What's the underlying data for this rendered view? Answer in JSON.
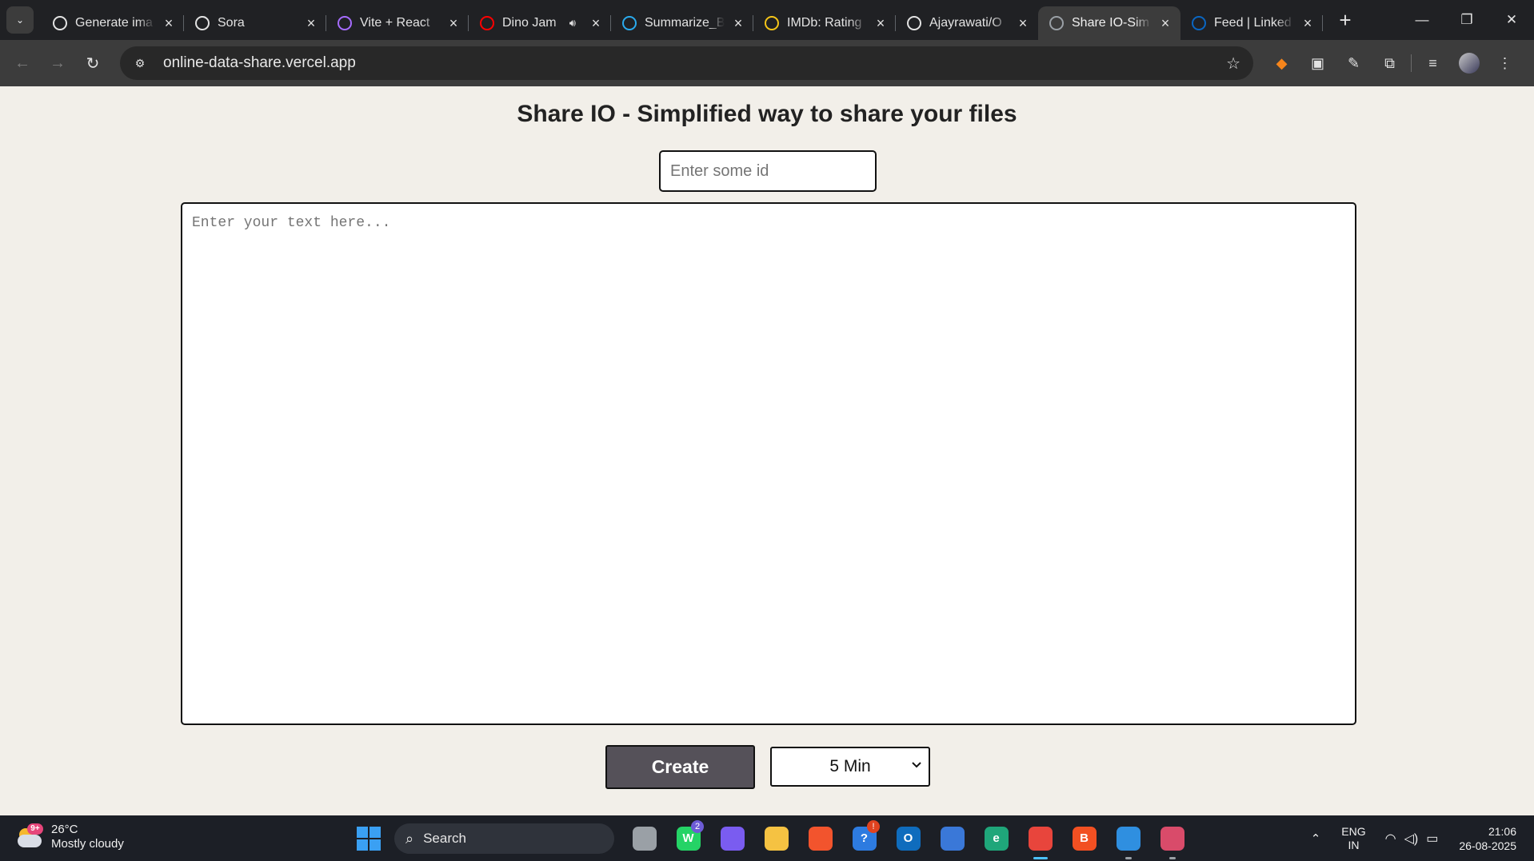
{
  "browser": {
    "tabs": [
      {
        "title": "Generate ima",
        "icon": "openai-icon",
        "icon_color": "#e3e3e3"
      },
      {
        "title": "Sora",
        "icon": "sora-icon",
        "icon_color": "#e3e3e3"
      },
      {
        "title": "Vite + React",
        "icon": "vite-icon",
        "icon_color": "#a66cff"
      },
      {
        "title": "Dino Jam",
        "icon": "youtube-icon",
        "icon_color": "#ff0000"
      },
      {
        "title": "Summarize_B",
        "icon": "telegram-icon",
        "icon_color": "#2aabee"
      },
      {
        "title": "IMDb: Rating",
        "icon": "imdb-icon",
        "icon_color": "#f5c518"
      },
      {
        "title": "Ajayrawati/O",
        "icon": "github-icon",
        "icon_color": "#e3e3e3"
      },
      {
        "title": "Share IO-Sim",
        "icon": "globe-icon",
        "icon_color": "#9aa0a6"
      },
      {
        "title": "Feed | Linked",
        "icon": "linkedin-icon",
        "icon_color": "#0a66c2"
      }
    ],
    "active_tab_index": 7,
    "url": "online-data-share.vercel.app"
  },
  "page": {
    "title": "Share IO - Simplified way to share your files",
    "id_input": {
      "placeholder": "Enter some id",
      "value": ""
    },
    "text_area": {
      "placeholder": "Enter your text here...",
      "value": ""
    },
    "create_button": "Create",
    "expiry_select": {
      "selected": "5 Min"
    }
  },
  "taskbar": {
    "weather": {
      "temp": "26°C",
      "condition": "Mostly cloudy",
      "badge": "9+"
    },
    "search_label": "Search",
    "apps": [
      {
        "name": "task-view",
        "color": "#9aa0a6",
        "glyph": "",
        "badge": "",
        "dot": ""
      },
      {
        "name": "whatsapp",
        "color": "#25d366",
        "glyph": "W",
        "badge": "2",
        "dot": ""
      },
      {
        "name": "copilot",
        "color": "#7a5cf0",
        "glyph": "",
        "badge": "",
        "dot": ""
      },
      {
        "name": "file-explorer",
        "color": "#f5c242",
        "glyph": "",
        "badge": "",
        "dot": ""
      },
      {
        "name": "git-app",
        "color": "#f2542d",
        "glyph": "",
        "badge": "",
        "dot": ""
      },
      {
        "name": "get-help",
        "color": "#2d7be0",
        "glyph": "?",
        "badge": "!",
        "dot": ""
      },
      {
        "name": "outlook",
        "color": "#0f6cbd",
        "glyph": "O",
        "badge": "",
        "dot": ""
      },
      {
        "name": "ms-store",
        "color": "#3a78d8",
        "glyph": "",
        "badge": "",
        "dot": ""
      },
      {
        "name": "edge",
        "color": "#1fa67a",
        "glyph": "e",
        "badge": "",
        "dot": ""
      },
      {
        "name": "chrome",
        "color": "#e8453c",
        "glyph": "",
        "badge": "",
        "dot": "active"
      },
      {
        "name": "brave",
        "color": "#f25022",
        "glyph": "B",
        "badge": "",
        "dot": ""
      },
      {
        "name": "vs-code",
        "color": "#2f8fe0",
        "glyph": "",
        "badge": "",
        "dot": "open"
      },
      {
        "name": "snipping-tool",
        "color": "#d94b6a",
        "glyph": "",
        "badge": "",
        "dot": "open"
      }
    ],
    "lang": {
      "line1": "ENG",
      "line2": "IN"
    },
    "time": "21:06",
    "date": "26-08-2025"
  }
}
